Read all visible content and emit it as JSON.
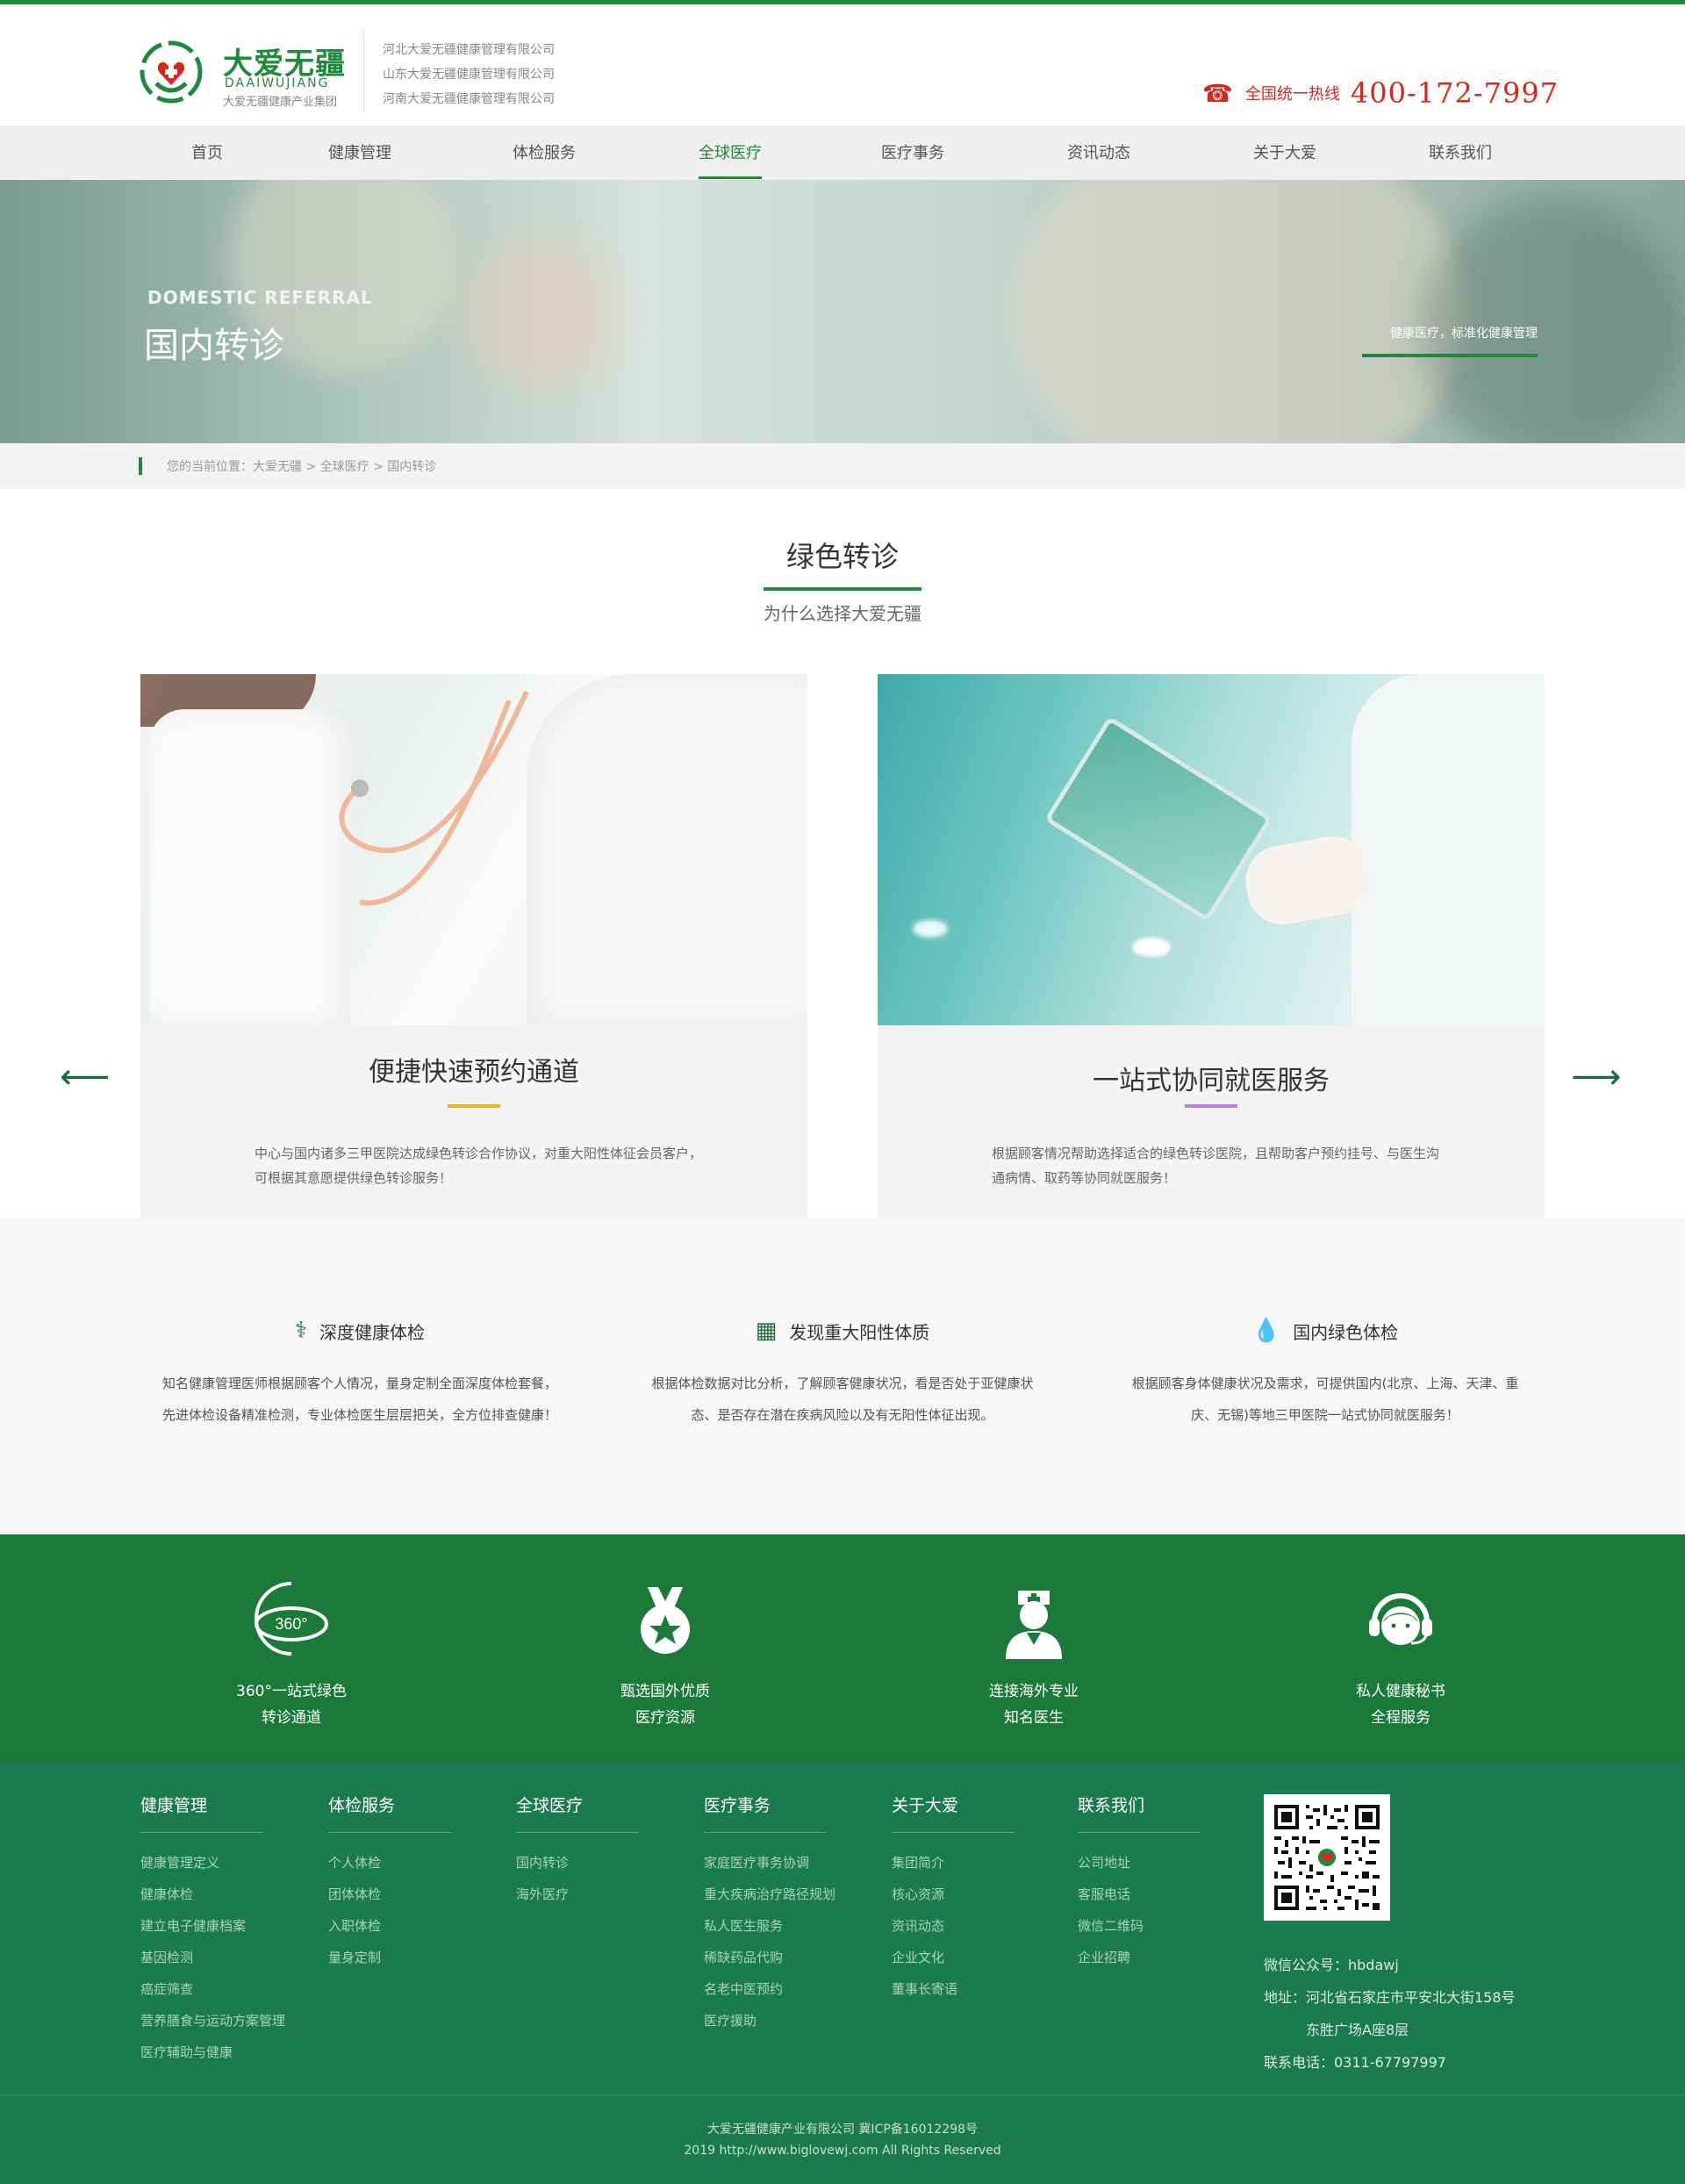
{
  "header": {
    "logo_cn": "大爱无疆",
    "logo_en": "DAAIWUJIANG",
    "logo_sub": "大爱无疆健康产业集团",
    "companies": [
      "河北大爱无疆健康管理有限公司",
      "山东大爱无疆健康管理有限公司",
      "河南大爱无疆健康管理有限公司"
    ],
    "hotline_label": "全国统一热线",
    "hotline_number": "400-172-7997"
  },
  "nav": [
    "首页",
    "健康管理",
    "体检服务",
    "全球医疗",
    "医疗事务",
    "资讯动态",
    "关于大爱",
    "联系我们"
  ],
  "nav_active": "全球医疗",
  "banner": {
    "en": "DOMESTIC REFERRAL",
    "cn": "国内转诊",
    "tagline": "健康医疗，标准化健康管理"
  },
  "breadcrumb": "您的当前位置：大爱无疆  >  全球医疗  >  国内转诊",
  "section": {
    "title": "绿色转诊",
    "subtitle": "为什么选择大爱无疆"
  },
  "cards": [
    {
      "title": "便捷快速预约通道",
      "desc": "中心与国内诸多三甲医院达成绿色转诊合作协议，对重大阳性体征会员客户，可根据其意愿提供绿色转诊服务！",
      "accent": "#e8b824"
    },
    {
      "title": "一站式协同就医服务",
      "desc": "根据顾客情况帮助选择适合的绿色转诊医院，且帮助客户预约挂号、与医生沟通病情、取药等协同就医服务！",
      "accent": "#c27be0"
    }
  ],
  "arrows": {
    "prev": "⟵",
    "next": "⟶"
  },
  "features": [
    {
      "icon": "stethoscope-icon",
      "title": "深度健康体检",
      "desc": "知名健康管理医师根据顾客个人情况，量身定制全面深度体检套餐，先进体检设备精准检测，专业体检医生层层把关，全方位排查健康！"
    },
    {
      "icon": "calendar-icon",
      "title": "发现重大阳性体质",
      "desc": "根据体检数据对比分析，了解顾客健康状况，看是否处于亚健康状态、是否存在潜在疾病风险以及有无阳性体征出现。"
    },
    {
      "icon": "drop-icon",
      "title": "国内绿色体检",
      "desc": "根据顾客身体健康状况及需求，可提供国内(北京、上海、天津、重庆、无锡)等地三甲医院一站式协同就医服务！"
    }
  ],
  "advantages": [
    {
      "icon": "360-icon",
      "line1": "360°一站式绿色",
      "line2": "转诊通道"
    },
    {
      "icon": "medal-icon",
      "line1": "甄选国外优质",
      "line2": "医疗资源"
    },
    {
      "icon": "doctor-icon",
      "line1": "连接海外专业",
      "line2": "知名医生"
    },
    {
      "icon": "headset-icon",
      "line1": "私人健康秘书",
      "line2": "全程服务"
    }
  ],
  "footer": {
    "columns": [
      {
        "title": "健康管理",
        "items": [
          "健康管理定义",
          "健康体检",
          "建立电子健康档案",
          "基因检测",
          "癌症筛查",
          "营养膳食与运动方案管理",
          "医疗辅助与健康"
        ]
      },
      {
        "title": "体检服务",
        "items": [
          "个人体检",
          "团体体检",
          "入职体检",
          "量身定制"
        ]
      },
      {
        "title": "全球医疗",
        "items": [
          "国内转诊",
          "海外医疗"
        ]
      },
      {
        "title": "医疗事务",
        "items": [
          "家庭医疗事务协调",
          "重大疾病治疗路径规划",
          "私人医生服务",
          "稀缺药品代购",
          "名老中医预约",
          "医疗援助"
        ]
      },
      {
        "title": "关于大爱",
        "items": [
          "集团简介",
          "核心资源",
          "资讯动态",
          "企业文化",
          "董事长寄语"
        ]
      },
      {
        "title": "联系我们",
        "items": [
          "公司地址",
          "客服电话",
          "微信二维码",
          "企业招聘"
        ]
      }
    ],
    "wechat": "微信公众号：hbdawj",
    "address1": "地址：河北省石家庄市平安北大街158号",
    "address2": "东胜广场A座8层",
    "phone": "联系电话：0311-67797997",
    "copyright1": "大爱无疆健康产业有限公司 冀ICP备16012298号",
    "copyright2": "2019 http://www.biglovewj.com All Rights Reserved"
  }
}
